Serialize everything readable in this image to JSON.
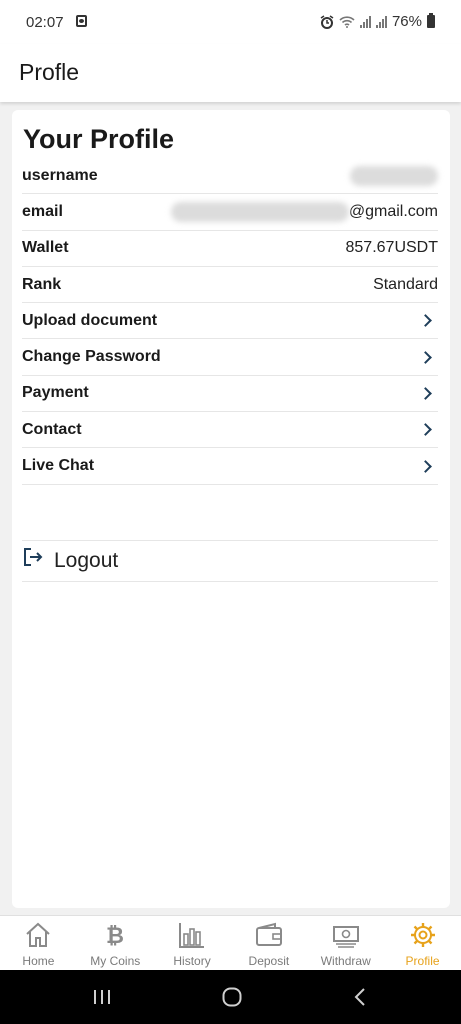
{
  "status": {
    "time": "02:07",
    "battery": "76%"
  },
  "app_bar": {
    "title": "Profle"
  },
  "profile": {
    "heading": "Your Profile",
    "rows": [
      {
        "label": "username",
        "value": ""
      },
      {
        "label": "email",
        "value": "@gmail.com"
      },
      {
        "label": "Wallet",
        "value": "857.67USDT"
      },
      {
        "label": "Rank",
        "value": "Standard"
      },
      {
        "label": "Upload document"
      },
      {
        "label": "Change Password"
      },
      {
        "label": "Payment"
      },
      {
        "label": "Contact"
      },
      {
        "label": "Live Chat"
      }
    ],
    "logout": "Logout"
  },
  "nav": {
    "items": [
      {
        "label": "Home",
        "icon": "home-icon"
      },
      {
        "label": "My Coins",
        "icon": "bitcoin-icon"
      },
      {
        "label": "History",
        "icon": "bar-chart-icon"
      },
      {
        "label": "Deposit",
        "icon": "wallet-icon"
      },
      {
        "label": "Withdraw",
        "icon": "cash-icon"
      },
      {
        "label": "Profile",
        "icon": "gear-icon"
      }
    ],
    "active": "Profile"
  },
  "colors": {
    "accent": "#e7a21b",
    "chevron": "#1f3e5a",
    "nav_inactive": "#7a7a7a"
  }
}
